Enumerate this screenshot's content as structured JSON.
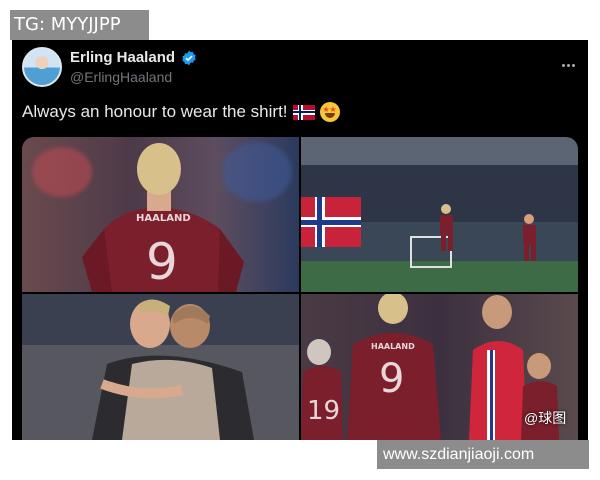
{
  "overlays": {
    "tg_label": "TG: MYYJJPP",
    "site_watermark": "www.szdianjiaoji.com",
    "qiutu_watermark": "@球图"
  },
  "tweet": {
    "display_name": "Erling Haaland",
    "handle": "@ErlingHaaland",
    "text": "Always an honour to wear the shirt!",
    "icons": [
      "verified-badge-icon",
      "more-options-icon",
      "norway-flag-icon",
      "star-struck-emoji-icon"
    ],
    "photos": [
      {
        "jersey_name": "HAALAND",
        "jersey_number": "9"
      },
      {
        "jersey_name": "",
        "jersey_number": ""
      },
      {
        "jersey_name": "",
        "jersey_number": ""
      },
      {
        "jersey_name": "HAALAND",
        "jersey_number": "9",
        "other_number": "19"
      }
    ]
  },
  "colors": {
    "tweet_bg": "#000000",
    "jersey": "#7a1f2b",
    "verified": "#1d9bf0",
    "handle": "#71767b"
  }
}
